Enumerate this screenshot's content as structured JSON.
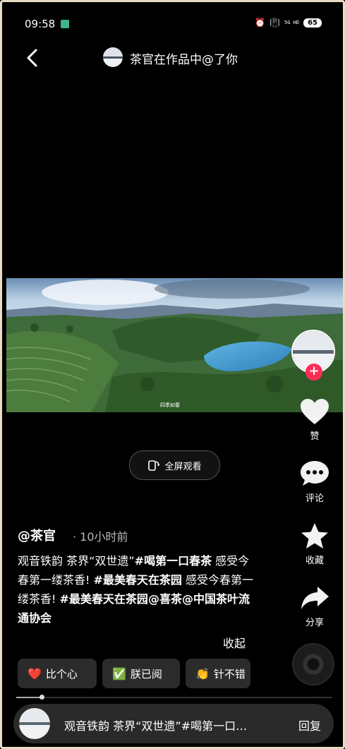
{
  "status_bar": {
    "time": "09:58",
    "network": "5G HD",
    "battery": "65",
    "icons": [
      "alarm-icon",
      "vibrate-icon",
      "signal-icon"
    ]
  },
  "header": {
    "title": "茶官在作品中@了你"
  },
  "video": {
    "caption": "四季如春"
  },
  "fullscreen": {
    "label": "全屏观看"
  },
  "actions": {
    "like": "赞",
    "comment": "评论",
    "favorite": "收藏",
    "share": "分享"
  },
  "post": {
    "author": "@茶官",
    "time_ago": "· 10小时前",
    "desc_plain_1": "观音铁韵  茶界“双世遗”",
    "desc_tag_1": "#喝第一口春茶",
    "desc_plain_2": " 感受今春第一缕茶香! ",
    "desc_tag_2": "#最美春天在茶园",
    "desc_plain_3": " 感受今春第一缕茶香! ",
    "desc_tag_3": "#最美春天在茶园",
    "desc_mention_1": "@喜茶",
    "desc_mention_2": "@中国茶叶流通协会",
    "collapse": "收起"
  },
  "chips": [
    {
      "icon": "heart-icon",
      "label": "比个心"
    },
    {
      "icon": "check-icon",
      "label": "朕已阅"
    },
    {
      "icon": "clap-icon",
      "label": "针不错"
    }
  ],
  "progress": 0.08,
  "bottom_bar": {
    "text": "观音铁韵  茶界“双世遗”#喝第一口…",
    "reply": "回复"
  },
  "colors": {
    "accent": "#ff2d55",
    "chip_bg": "#2b2b2b",
    "background": "#000000"
  }
}
